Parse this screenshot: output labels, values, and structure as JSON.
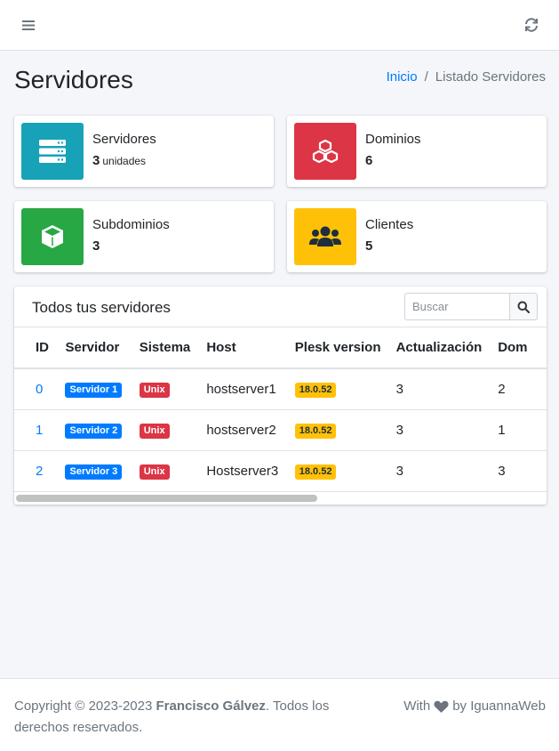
{
  "navbar": {
    "menu_icon": "bars-icon",
    "refresh_icon": "refresh-icon"
  },
  "header": {
    "title": "Servidores",
    "breadcrumb": {
      "home": "Inicio",
      "separator": "/",
      "current": "Listado Servidores"
    }
  },
  "stats": [
    {
      "label": "Servidores",
      "value": "3",
      "unit": "unidades",
      "color": "#17a2b8",
      "icon": "server-icon"
    },
    {
      "label": "Dominios",
      "value": "6",
      "unit": "",
      "color": "#dc3545",
      "icon": "cubes-icon"
    },
    {
      "label": "Subdominios",
      "value": "3",
      "unit": "",
      "color": "#28a745",
      "icon": "cube-icon"
    },
    {
      "label": "Clientes",
      "value": "5",
      "unit": "",
      "color": "#ffc107",
      "icon": "users-icon"
    }
  ],
  "card": {
    "title": "Todos tus servidores",
    "search_placeholder": "Buscar",
    "columns": [
      "ID",
      "Servidor",
      "Sistema",
      "Host",
      "Plesk version",
      "Actualización",
      "Dom"
    ],
    "rows": [
      {
        "id": "0",
        "server": "Servidor 1",
        "system": "Unix",
        "host": "hostserver1",
        "plesk": "18.0.52",
        "updates": "3",
        "domains": "2"
      },
      {
        "id": "1",
        "server": "Servidor 2",
        "system": "Unix",
        "host": "hostserver2",
        "plesk": "18.0.52",
        "updates": "3",
        "domains": "1"
      },
      {
        "id": "2",
        "server": "Servidor 3",
        "system": "Unix",
        "host": "Hostserver3",
        "plesk": "18.0.52",
        "updates": "3",
        "domains": "3"
      }
    ]
  },
  "footer": {
    "copyright_prefix": "Copyright © 2023-2023 ",
    "author": "Francisco Gálvez",
    "copyright_suffix": ". Todos los derechos reservados.",
    "with": "With",
    "by": "by IguannaWeb"
  }
}
